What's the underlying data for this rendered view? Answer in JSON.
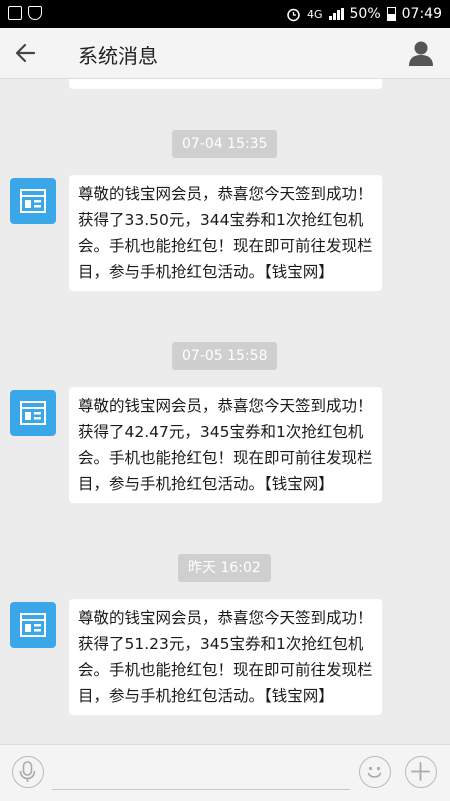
{
  "status_bar": {
    "network": "4G",
    "battery_text": "50%",
    "battery_level": 0.5,
    "time": "07:49",
    "icons": [
      "photo-notification-icon",
      "shield-notification-icon",
      "alarm-icon",
      "signal-icon",
      "battery-icon"
    ]
  },
  "header": {
    "title": "系统消息",
    "back_icon": "arrow-left-icon",
    "profile_icon": "user-icon"
  },
  "messages": [
    {
      "time": "07-04 15:35",
      "text": "尊敬的钱宝网会员，恭喜您今天签到成功！获得了33.50元，344宝券和1次抢红包机会。手机也能抢红包！现在即可前往发现栏目，参与手机抢红包活动。【钱宝网】"
    },
    {
      "time": "07-05 15:58",
      "text": "尊敬的钱宝网会员，恭喜您今天签到成功！获得了42.47元，345宝券和1次抢红包机会。手机也能抢红包！现在即可前往发现栏目，参与手机抢红包活动。【钱宝网】"
    },
    {
      "time": "昨天 16:02",
      "text": "尊敬的钱宝网会员，恭喜您今天签到成功！获得了51.23元，345宝券和1次抢红包机会。手机也能抢红包！现在即可前往发现栏目，参与手机抢红包活动。【钱宝网】"
    }
  ],
  "input_bar": {
    "icons": [
      "microphone-icon",
      "emoji-icon",
      "plus-icon"
    ]
  },
  "colors": {
    "background": "#ececec",
    "avatar": "#3aa7e8",
    "time_chip": "#cfcfcf",
    "status_bar": "#000000"
  }
}
